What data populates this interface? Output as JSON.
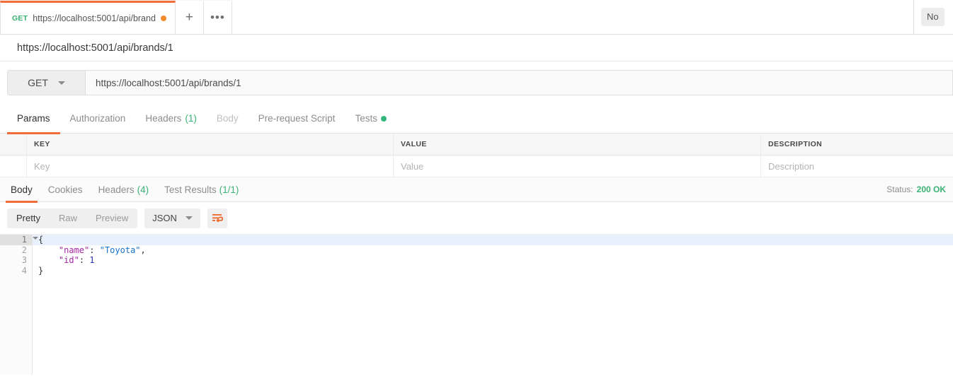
{
  "tabstrip": {
    "request_tab": {
      "method": "GET",
      "url": "https://localhost:5001/api/brand",
      "unsaved_icon": "unsaved-dot"
    },
    "new_tab_label": "+",
    "more_label": "•••",
    "environment_selector": "No"
  },
  "request": {
    "name": "https://localhost:5001/api/brands/1",
    "method": "GET",
    "url": "https://localhost:5001/api/brands/1"
  },
  "request_tabs": [
    {
      "label": "Params",
      "count": "",
      "active": true,
      "disabled": false,
      "dot": false
    },
    {
      "label": "Authorization",
      "count": "",
      "active": false,
      "disabled": false,
      "dot": false
    },
    {
      "label": "Headers",
      "count": "(1)",
      "active": false,
      "disabled": false,
      "dot": false
    },
    {
      "label": "Body",
      "count": "",
      "active": false,
      "disabled": true,
      "dot": false
    },
    {
      "label": "Pre-request Script",
      "count": "",
      "active": false,
      "disabled": false,
      "dot": false
    },
    {
      "label": "Tests",
      "count": "",
      "active": false,
      "disabled": false,
      "dot": true
    }
  ],
  "params_table": {
    "headers": {
      "key": "KEY",
      "value": "VALUE",
      "description": "DESCRIPTION"
    },
    "placeholders": {
      "key": "Key",
      "value": "Value",
      "description": "Description"
    }
  },
  "response_tabs": [
    {
      "label": "Body",
      "count": "",
      "active": true
    },
    {
      "label": "Cookies",
      "count": "",
      "active": false
    },
    {
      "label": "Headers",
      "count": "(4)",
      "active": false
    },
    {
      "label": "Test Results",
      "count": "(1/1)",
      "active": false
    }
  ],
  "response_status": {
    "label": "Status:",
    "value": "200 OK"
  },
  "view_toolbar": {
    "modes": [
      {
        "label": "Pretty",
        "active": true
      },
      {
        "label": "Raw",
        "active": false
      },
      {
        "label": "Preview",
        "active": false
      }
    ],
    "format": "JSON",
    "wrap_icon": "word-wrap-icon"
  },
  "response_body": {
    "language": "json",
    "lines": [
      {
        "number": "1",
        "fold": true,
        "active": true,
        "segments": [
          {
            "text": "{",
            "type": "punct"
          }
        ]
      },
      {
        "number": "2",
        "fold": false,
        "active": false,
        "segments": [
          {
            "text": "    ",
            "type": "punct"
          },
          {
            "text": "\"name\"",
            "type": "key"
          },
          {
            "text": ": ",
            "type": "punct"
          },
          {
            "text": "\"Toyota\"",
            "type": "string"
          },
          {
            "text": ",",
            "type": "punct"
          }
        ]
      },
      {
        "number": "3",
        "fold": false,
        "active": false,
        "segments": [
          {
            "text": "    ",
            "type": "punct"
          },
          {
            "text": "\"id\"",
            "type": "key"
          },
          {
            "text": ": ",
            "type": "punct"
          },
          {
            "text": "1",
            "type": "number"
          }
        ]
      },
      {
        "number": "4",
        "fold": false,
        "active": false,
        "segments": [
          {
            "text": "}",
            "type": "punct"
          }
        ]
      }
    ],
    "parsed": {
      "name": "Toyota",
      "id": 1
    }
  },
  "colors": {
    "accent_orange": "#f26b3a",
    "success_green": "#3bb273",
    "unsaved_orange": "#f28b2b",
    "active_line": "#e8f0fd",
    "json_key": "#a626a4",
    "json_string": "#1673cc",
    "json_number": "#2233aa"
  }
}
